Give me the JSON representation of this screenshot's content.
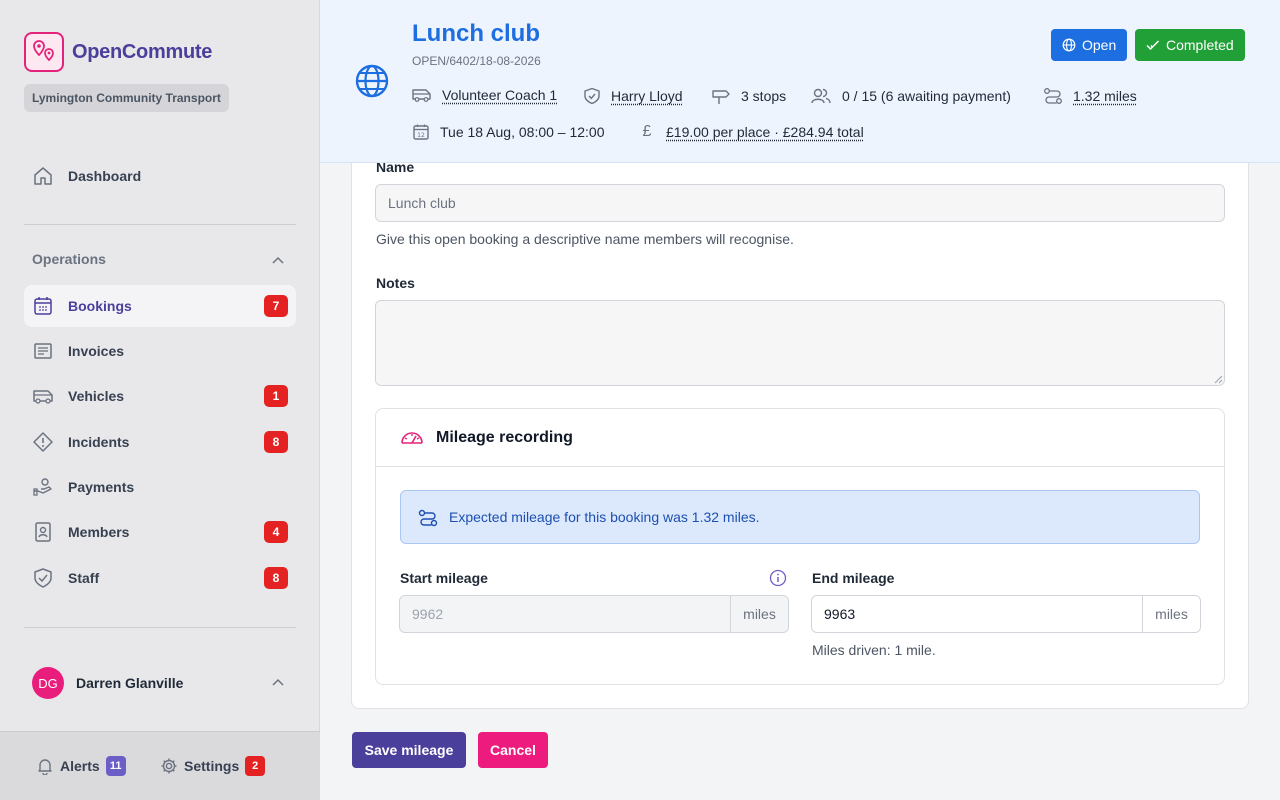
{
  "colors": {
    "brand": "#4b3f9c",
    "accent_pink": "#e3237a",
    "header_title": "#1d6ee0",
    "badge_red": "#e52222",
    "open_blue": "#1d6ee0",
    "completed_green": "#21a038",
    "save_purple": "#4b3f9c",
    "cancel_pink": "#ee1b7e"
  },
  "sidebar": {
    "brand_name": "OpenCommute",
    "org_name": "Lymington Community Transport",
    "dashboard_label": "Dashboard",
    "section_title": "Operations",
    "items": [
      {
        "label": "Bookings",
        "icon": "calendar-icon",
        "badge": "7"
      },
      {
        "label": "Invoices",
        "icon": "invoice-icon",
        "badge": ""
      },
      {
        "label": "Vehicles",
        "icon": "bus-icon",
        "badge": "1"
      },
      {
        "label": "Incidents",
        "icon": "warning-icon",
        "badge": "8"
      },
      {
        "label": "Payments",
        "icon": "payment-hand-icon",
        "badge": ""
      },
      {
        "label": "Members",
        "icon": "id-badge-icon",
        "badge": "4"
      },
      {
        "label": "Staff",
        "icon": "shield-check-icon",
        "badge": "8"
      }
    ],
    "user": {
      "initials": "DG",
      "name": "Darren Glanville"
    },
    "bottom": {
      "alerts_label": "Alerts",
      "alerts_count": "11",
      "settings_label": "Settings",
      "settings_count": "2"
    }
  },
  "header": {
    "title": "Lunch club",
    "reference": "OPEN/6402/18-08-2026",
    "vehicle": "Volunteer Coach 1",
    "driver": "Harry Lloyd",
    "stops": "3 stops",
    "capacity": "0 / 15 (6 awaiting payment)",
    "distance": "1.32 miles",
    "datetime": "Tue 18 Aug, 08:00 – 12:00",
    "price": "£19.00 per place · £284.94 total",
    "open_label": "Open",
    "completed_label": "Completed"
  },
  "form": {
    "name_label": "Name",
    "name_value": "Lunch club",
    "name_helper": "Give this open booking a descriptive name members will recognise.",
    "notes_label": "Notes",
    "notes_value": ""
  },
  "mileage": {
    "title": "Mileage recording",
    "info": "Expected mileage for this booking was 1.32 miles.",
    "start_label": "Start mileage",
    "start_value": "9962",
    "end_label": "End mileage",
    "end_value": "9963",
    "unit": "miles",
    "driven_text": "Miles driven: 1 mile."
  },
  "actions": {
    "save_label": "Save mileage",
    "cancel_label": "Cancel"
  }
}
